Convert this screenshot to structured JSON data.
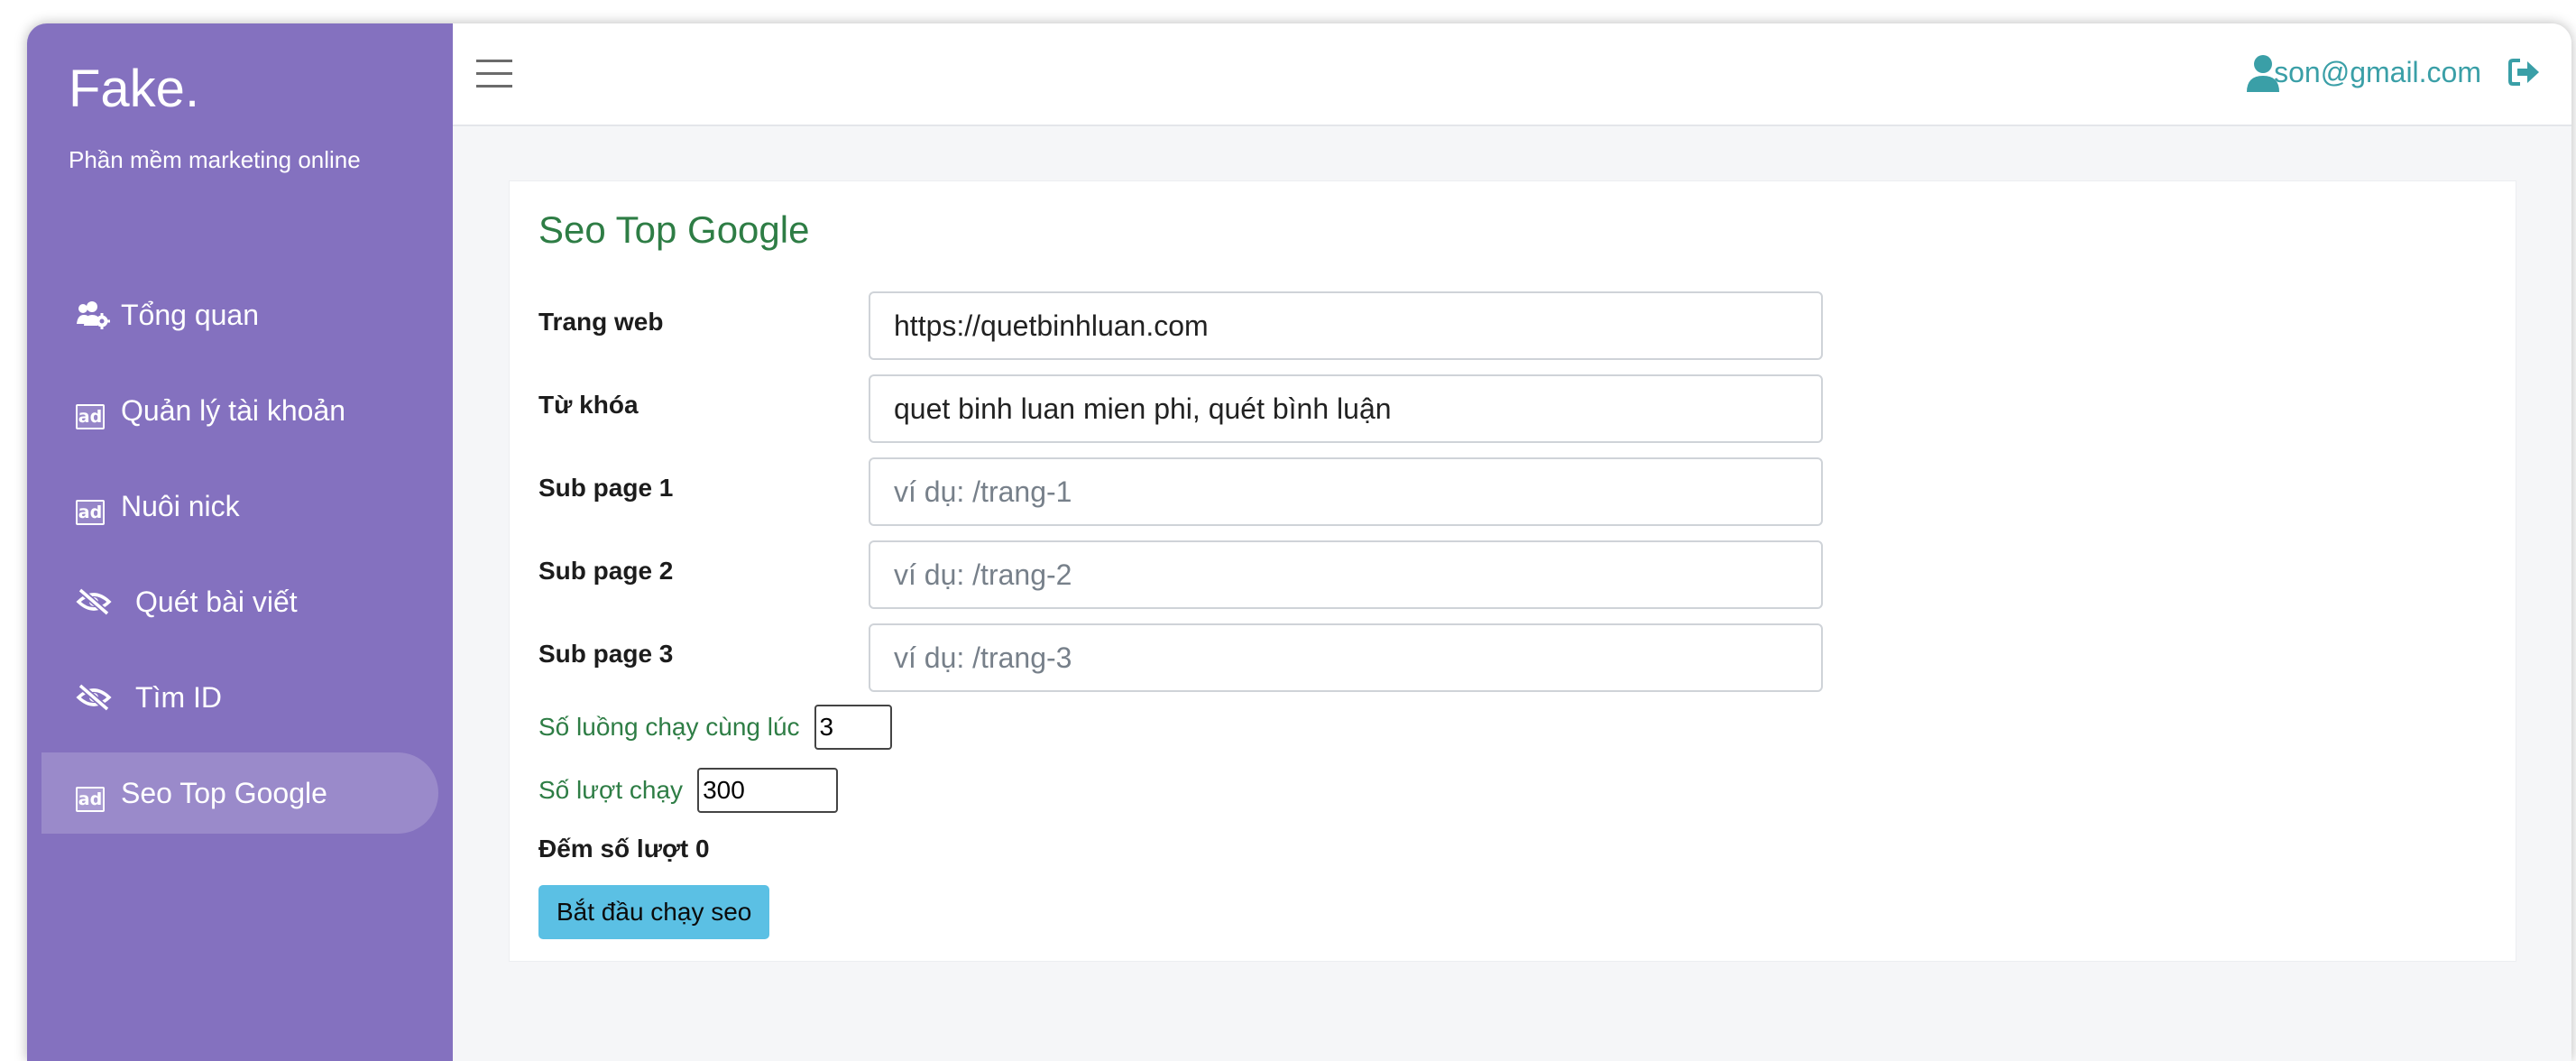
{
  "brand": {
    "title": "Fake.",
    "tagline": "Phần mềm marketing online"
  },
  "sidebar": {
    "items": [
      {
        "label": "Tổng quan",
        "icon": "users-cog-icon",
        "active": false
      },
      {
        "label": "Quản lý tài khoản",
        "icon": "ad-icon",
        "active": false
      },
      {
        "label": "Nuôi nick",
        "icon": "ad-icon",
        "active": false
      },
      {
        "label": "Quét bài viết",
        "icon": "eye-slash-icon",
        "active": false
      },
      {
        "label": "Tìm ID",
        "icon": "eye-slash-icon",
        "active": false
      },
      {
        "label": "Seo Top Google",
        "icon": "ad-icon",
        "active": true
      }
    ],
    "badge_text": "ad"
  },
  "header": {
    "menu_icon": "hamburger-icon",
    "user_icon": "user-icon",
    "email": "son@gmail.com",
    "logout_icon": "sign-out-icon"
  },
  "main": {
    "title": "Seo Top Google",
    "fields": [
      {
        "label": "Trang web",
        "value": "https://quetbinhluan.com",
        "placeholder": ""
      },
      {
        "label": "Từ khóa",
        "value": "quet binh luan mien phi, quét bình luận",
        "placeholder": ""
      },
      {
        "label": "Sub page 1",
        "value": "",
        "placeholder": "ví dụ: /trang-1"
      },
      {
        "label": "Sub page 2",
        "value": "",
        "placeholder": "ví dụ: /trang-2"
      },
      {
        "label": "Sub page 3",
        "value": "",
        "placeholder": "ví dụ: /trang-3"
      }
    ],
    "threads_label": "Số luồng chạy cùng lúc",
    "threads_value": "3",
    "runs_label": "Số lượt chạy",
    "runs_value": "300",
    "count_label": "Đếm số lượt 0",
    "start_button": "Bắt đầu chạy seo"
  },
  "colors": {
    "sidebar": "#8471bf",
    "title_green": "#2e7d45",
    "email_teal": "#3a9fa7",
    "button_blue": "#5bc0e4"
  }
}
